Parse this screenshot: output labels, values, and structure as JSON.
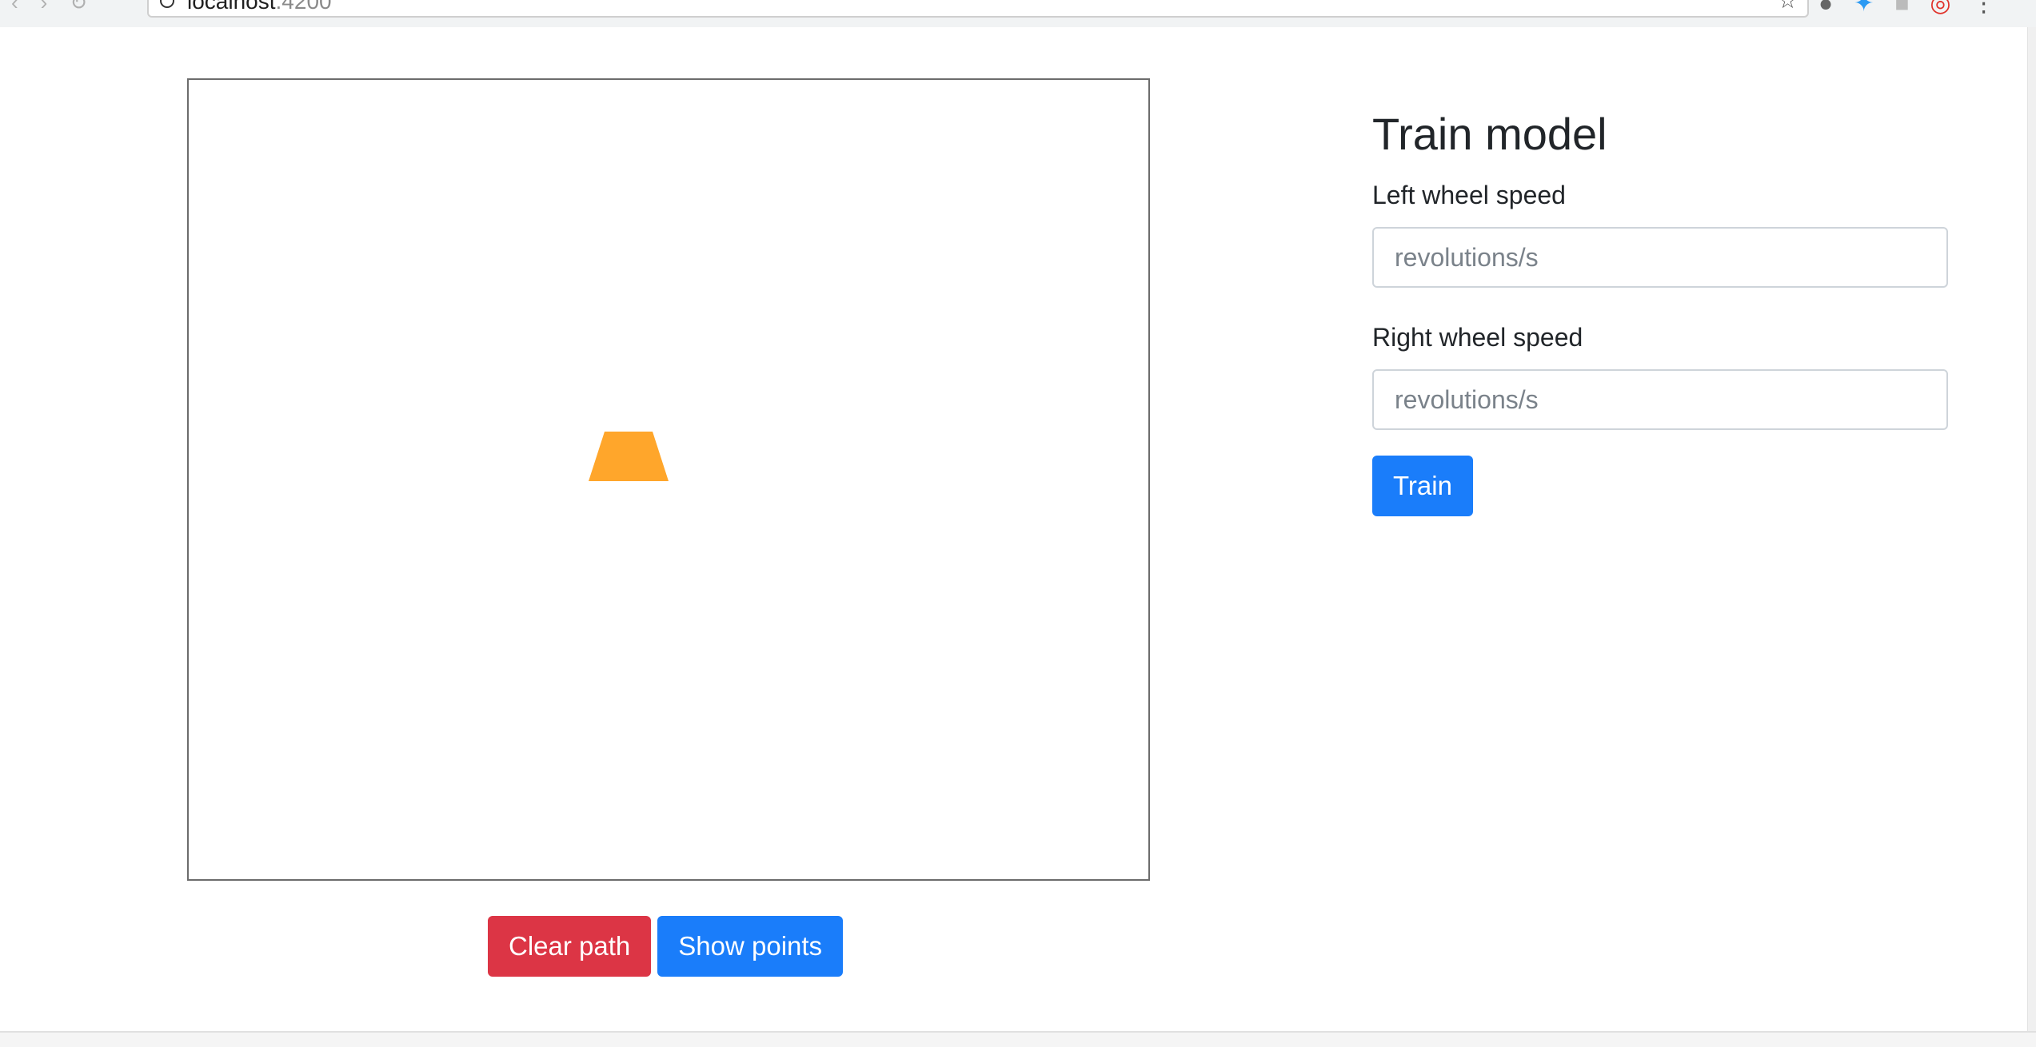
{
  "browser": {
    "address": "localhost",
    "port": ":4200"
  },
  "simulator": {
    "robot_color": "#ffa62b",
    "clear_path_label": "Clear path",
    "show_points_label": "Show points"
  },
  "train_panel": {
    "title": "Train model",
    "left_label": "Left wheel speed",
    "left_placeholder": "revolutions/s",
    "right_label": "Right wheel speed",
    "right_placeholder": "revolutions/s",
    "train_label": "Train"
  },
  "colors": {
    "danger": "#dc3545",
    "primary": "#1a7dfa"
  }
}
